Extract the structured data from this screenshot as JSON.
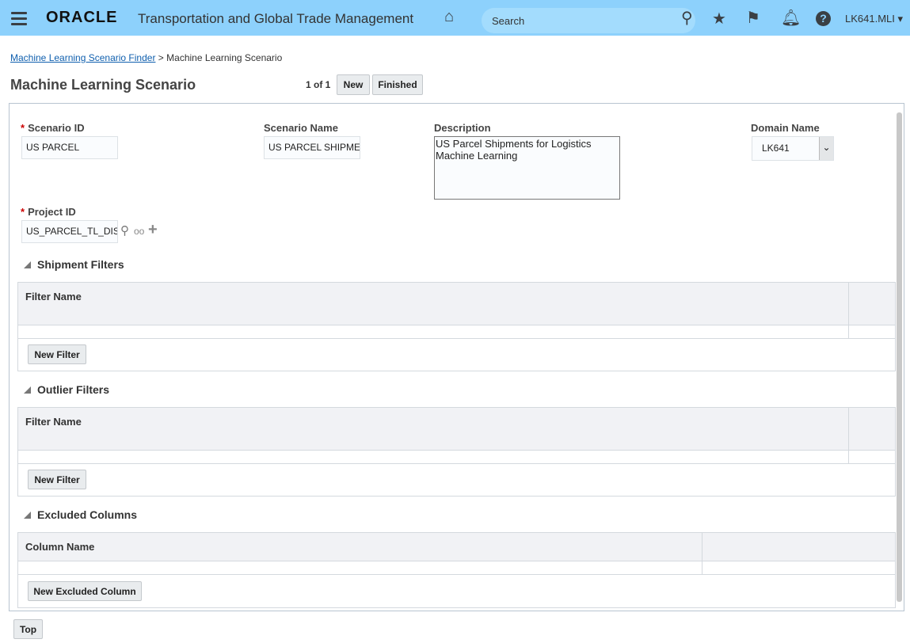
{
  "header": {
    "logo": "ORACLE",
    "app_title": "Transportation and Global Trade Management",
    "search_placeholder": "Search",
    "user": "LK641.MLI"
  },
  "breadcrumb": {
    "link": "Machine Learning Scenario Finder",
    "sep": ">",
    "current": "Machine Learning Scenario"
  },
  "page": {
    "title": "Machine Learning Scenario",
    "pager": "1 of 1",
    "new_label": "New",
    "finished_label": "Finished"
  },
  "form": {
    "scenario_id": {
      "label": "Scenario ID",
      "value": "US PARCEL"
    },
    "scenario_name": {
      "label": "Scenario Name",
      "value": "US PARCEL SHIPMENTS"
    },
    "description": {
      "label": "Description",
      "value": "US Parcel Shipments for Logistics Machine Learning"
    },
    "domain_name": {
      "label": "Domain Name",
      "value": "LK641"
    },
    "project_id": {
      "label": "Project ID",
      "value": "US_PARCEL_TL_DIST"
    }
  },
  "sections": {
    "shipment": {
      "title": "Shipment Filters",
      "column": "Filter Name",
      "button": "New Filter"
    },
    "outlier": {
      "title": "Outlier Filters",
      "column": "Filter Name",
      "button": "New Filter"
    },
    "excluded": {
      "title": "Excluded Columns",
      "column": "Column Name",
      "button": "New Excluded Column"
    }
  },
  "footer": {
    "top_label": "Top"
  }
}
